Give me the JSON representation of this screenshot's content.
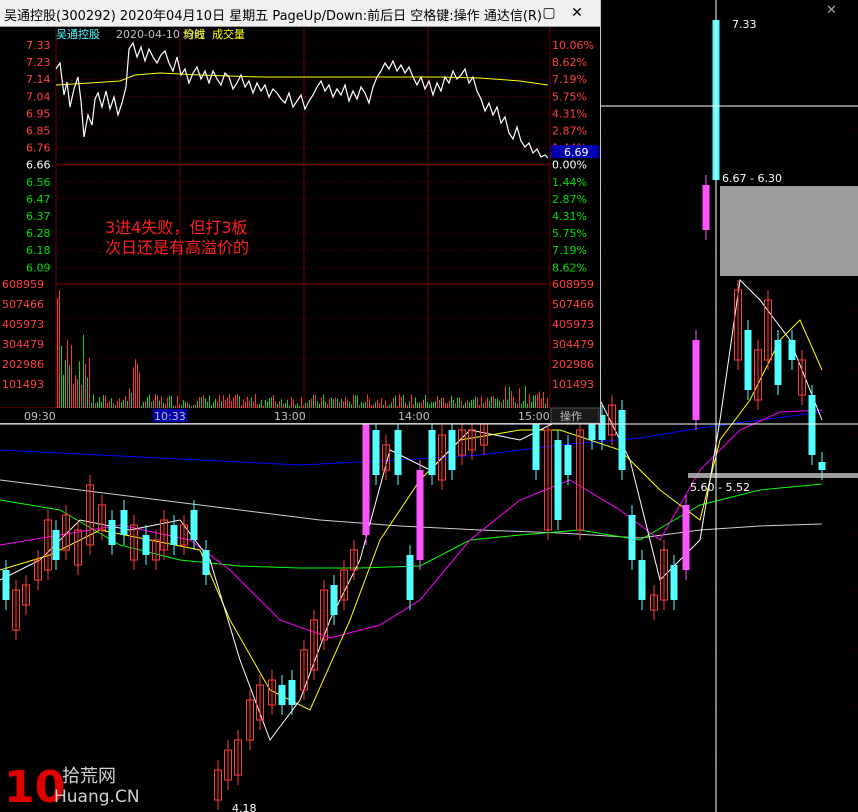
{
  "window": {
    "title": "吴通控股(300292) 2020年04月10日 星期五 PageUp/Down:前后日 空格键:操作 通达信(R)",
    "min_icon": "minimize-icon",
    "max_icon": "maximize-icon",
    "close_icon": "close-icon"
  },
  "intraday": {
    "stock_name": "吴通控股",
    "date_label": "2020-04-10 分时",
    "avg_label": "均线",
    "vol_label": "成交量",
    "price_ticks": [
      "7.33",
      "7.23",
      "7.14",
      "7.04",
      "6.95",
      "6.85",
      "6.76",
      "6.66",
      "6.56",
      "6.47",
      "6.37",
      "6.28",
      "6.18",
      "6.09"
    ],
    "pct_ticks": [
      "10.06%",
      "8.62%",
      "7.19%",
      "5.75%",
      "4.31%",
      "2.87%",
      "1.44%",
      "0.00%",
      "1.44%",
      "2.87%",
      "4.31%",
      "5.75%",
      "7.19%",
      "8.62%"
    ],
    "current_price": "6.69",
    "vol_ticks": [
      "608959",
      "507466",
      "405973",
      "304479",
      "202986",
      "101493"
    ],
    "time_labels": [
      "09:30",
      "10:33",
      "13:00",
      "14:00",
      "15:00"
    ],
    "op_button": "操作",
    "annotation_line1": "3进4失败，但打3板",
    "annotation_line2": "次日还是有高溢价的",
    "colors": {
      "up": "#ff3232",
      "down": "#54ffff",
      "avg": "#ffff00",
      "price_line": "#ffffff",
      "axis_up": "#ff4040",
      "axis_down": "#00e000",
      "grid": "#8b0000"
    }
  },
  "kline": {
    "high_label": "7.33",
    "range_label": "6.67 - 6.30",
    "gap_label": "5.60 - 5.52",
    "low_label": "4.18",
    "colors": {
      "up": "#ff3c3c",
      "down": "#54ffff",
      "limit": "#ff55ff",
      "ma5": "#ffffff",
      "ma10": "#ffff00",
      "ma20": "#ff00ff",
      "ma60": "#00ff00",
      "ma120": "#0000ff",
      "ma250": "#d0d0d0"
    }
  },
  "watermark": {
    "logo_text": "10",
    "brand_cn": "拾荒网",
    "brand_en": "Huang.CN"
  }
}
